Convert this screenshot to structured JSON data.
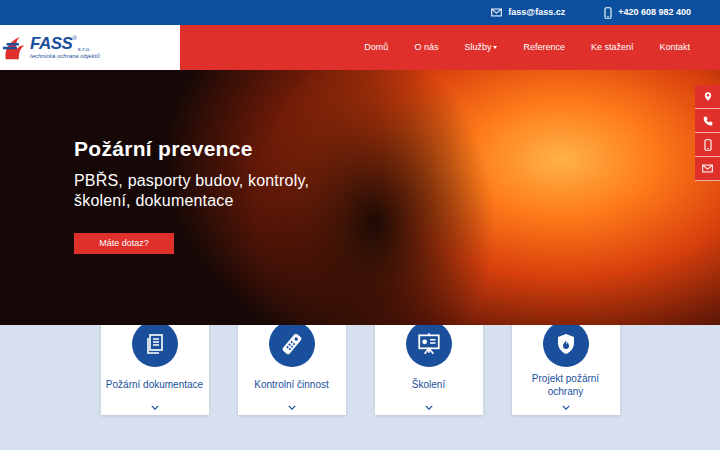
{
  "topbar": {
    "email": "fass@fass.cz",
    "phone": "+420 608 982 400"
  },
  "logo": {
    "name": "FASS",
    "registered": "®",
    "suffix": "s.r.o.",
    "tagline": "technická ochrana objektů"
  },
  "nav": {
    "items": [
      {
        "label": "Domů",
        "kind": "link"
      },
      {
        "label": "O nás",
        "kind": "link"
      },
      {
        "label": "Služby",
        "kind": "dropdown"
      },
      {
        "label": "Reference",
        "kind": "link"
      },
      {
        "label": "Ke stažení",
        "kind": "link"
      },
      {
        "label": "Kontakt",
        "kind": "link"
      }
    ]
  },
  "hero": {
    "title": "Požární prevence",
    "subtitle": "PBŘS, pasporty budov, kontroly, školení, dokumentace",
    "button": "Máte dotaz?"
  },
  "side_buttons": [
    {
      "kind": "location"
    },
    {
      "kind": "phone"
    },
    {
      "kind": "mobile"
    },
    {
      "kind": "email"
    }
  ],
  "services": [
    {
      "label": "Požární dokumentace",
      "kind": "documents"
    },
    {
      "label": "Kontrolní činnost",
      "kind": "remote"
    },
    {
      "label": "Školení",
      "kind": "training"
    },
    {
      "label": "Projekt požární ochrany",
      "kind": "shield"
    }
  ]
}
